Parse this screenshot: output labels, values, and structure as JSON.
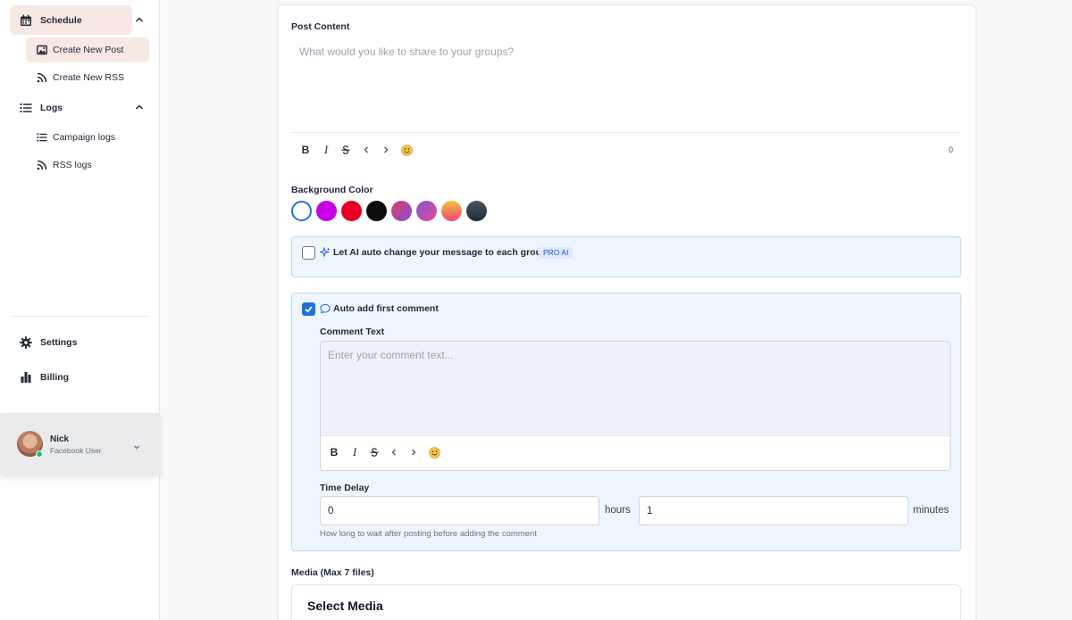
{
  "sidebar": {
    "schedule_label": "Schedule",
    "create_post_label": "Create New Post",
    "create_rss_label": "Create New RSS",
    "logs_label": "Logs",
    "campaign_logs_label": "Campaign logs",
    "rss_logs_label": "RSS logs",
    "settings_label": "Settings",
    "billing_label": "Billing"
  },
  "user": {
    "name": "Nick",
    "role": "Facebook User"
  },
  "post": {
    "label": "Post Content",
    "placeholder": "What would you like to share to your groups?",
    "char_count": "0"
  },
  "background": {
    "label": "Background Color",
    "swatches": [
      "#ffffff",
      "#c800e6",
      "#e60026",
      "#0d0d0d",
      "gradient-red-purple",
      "gradient-pink-purple",
      "gradient-orange-pink",
      "gradient-dark-slate"
    ],
    "selected": "#ffffff"
  },
  "ai_option": {
    "label": "Let AI auto change your message to each group",
    "badge": "PRO AI",
    "checked": false
  },
  "first_comment": {
    "label": "Auto add first comment",
    "checked": true,
    "comment_label": "Comment Text",
    "comment_placeholder": "Enter your comment text...",
    "delay_label": "Time Delay",
    "hours_value": "0",
    "hours_unit": "hours",
    "minutes_value": "1",
    "minutes_unit": "minutes",
    "help": "How long to wait after posting before adding the comment"
  },
  "media": {
    "label": "Media (Max 7 files)",
    "title": "Select Media"
  },
  "colors": {
    "accent": "#1d72e0",
    "nav_active": "#f7e8e4",
    "panel_bg": "#eef5fd"
  }
}
